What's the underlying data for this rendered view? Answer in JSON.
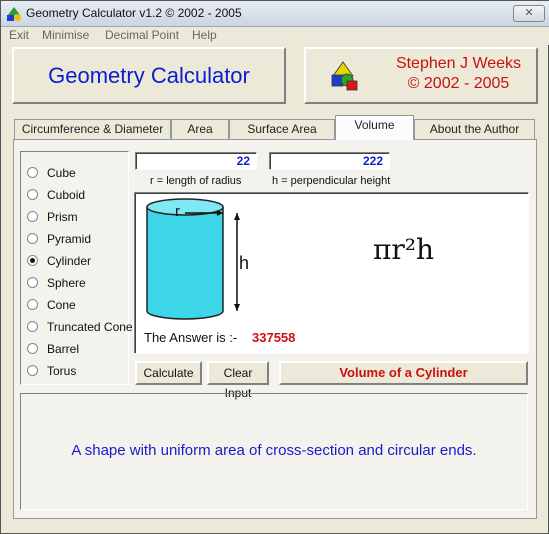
{
  "window": {
    "title": "Geometry Calculator v1.2 ©  2002 - 2005",
    "close_glyph": "✕"
  },
  "menu": [
    "Exit",
    "Minimise",
    "Decimal Point",
    "Help"
  ],
  "header": {
    "title": "Geometry Calculator",
    "author_line1": "Stephen J Weeks",
    "author_line2": "© 2002 - 2005"
  },
  "tabs": [
    {
      "label": "Circumference & Diameter",
      "active": false
    },
    {
      "label": "Area",
      "active": false
    },
    {
      "label": "Surface Area",
      "active": false
    },
    {
      "label": "Volume",
      "active": true
    },
    {
      "label": "About the Author",
      "active": false
    }
  ],
  "shapes": [
    {
      "label": "Cube",
      "selected": false
    },
    {
      "label": "Cuboid",
      "selected": false
    },
    {
      "label": "Prism",
      "selected": false
    },
    {
      "label": "Pyramid",
      "selected": false
    },
    {
      "label": "Cylinder",
      "selected": true
    },
    {
      "label": "Sphere",
      "selected": false
    },
    {
      "label": "Cone",
      "selected": false
    },
    {
      "label": "Truncated Cone",
      "selected": false
    },
    {
      "label": "Barrel",
      "selected": false
    },
    {
      "label": "Torus",
      "selected": false
    }
  ],
  "inputs": {
    "radius_value": "22",
    "height_value": "222",
    "radius_caption": "r = length of radius",
    "height_caption": "h = perpendicular height"
  },
  "diagram": {
    "r_label": "r",
    "h_label": "h",
    "formula": "πr²h",
    "answer_label": "The Answer is :-",
    "answer_value": "337558"
  },
  "buttons": {
    "calculate": "Calculate",
    "clear_input": "Clear Input"
  },
  "shape_title": "Volume of a Cylinder",
  "description": "A shape with uniform area of cross-section and circular ends.",
  "colors": {
    "accent_blue": "#0b1fcc",
    "accent_red": "#cc1010",
    "cylinder_fill": "#3dd6e8"
  }
}
